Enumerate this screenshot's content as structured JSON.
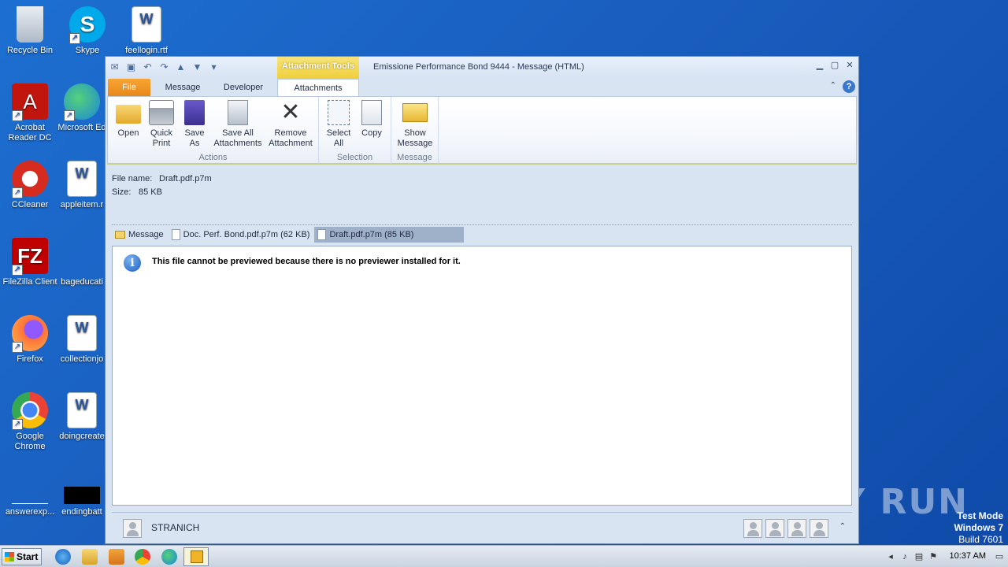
{
  "desktop": {
    "icons": [
      {
        "label": "Recycle Bin"
      },
      {
        "label": "Skype"
      },
      {
        "label": "feellogin.rtf"
      },
      {
        "label": "Acrobat Reader DC"
      },
      {
        "label": "Microsoft Ed"
      },
      {
        "label": "CCleaner"
      },
      {
        "label": "appleitem.r"
      },
      {
        "label": "FileZilla Client"
      },
      {
        "label": "bageducati"
      },
      {
        "label": "Firefox"
      },
      {
        "label": "collectionjo"
      },
      {
        "label": "Google Chrome"
      },
      {
        "label": "doingcreate"
      },
      {
        "label": "answerexp..."
      },
      {
        "label": "endingbatt"
      }
    ],
    "watermark": "ANY RUN",
    "test_mode": {
      "line1": "Test Mode",
      "line2": "Windows 7",
      "line3": "Build 7601"
    }
  },
  "window": {
    "contextual_tab_group": "Attachment Tools",
    "title": "Emissione Performance Bond 9444 -  Message (HTML)",
    "tabs": [
      {
        "label": "File"
      },
      {
        "label": "Message"
      },
      {
        "label": "Developer"
      },
      {
        "label": "Attachments"
      }
    ],
    "help_label": "?",
    "ribbon": {
      "groups": [
        {
          "label": "Actions",
          "buttons": [
            {
              "line1": "Open",
              "line2": "",
              "icon": "folder-open-icon"
            },
            {
              "line1": "Quick",
              "line2": "Print",
              "icon": "printer-icon"
            },
            {
              "line1": "Save",
              "line2": "As",
              "icon": "save-as-icon"
            },
            {
              "line1": "Save All",
              "line2": "Attachments",
              "icon": "save-all-icon"
            },
            {
              "line1": "Remove",
              "line2": "Attachment",
              "icon": "remove-x-icon"
            }
          ]
        },
        {
          "label": "Selection",
          "buttons": [
            {
              "line1": "Select",
              "line2": "All",
              "icon": "select-all-icon"
            },
            {
              "line1": "Copy",
              "line2": "",
              "icon": "copy-icon"
            }
          ]
        },
        {
          "label": "Message",
          "buttons": [
            {
              "line1": "Show",
              "line2": "Message",
              "icon": "envelope-icon"
            }
          ]
        }
      ]
    },
    "attachment_info": {
      "file_name_label": "File name:",
      "file_name": "Draft.pdf.p7m",
      "size_label": "Size:",
      "size": "85 KB"
    },
    "attachment_tabs": [
      {
        "label": "Message"
      },
      {
        "label": "Doc. Perf. Bond.pdf.p7m (62 KB)"
      },
      {
        "label": "Draft.pdf.p7m (85 KB)"
      }
    ],
    "preview_message": "This file cannot be previewed because there is no previewer installed for it.",
    "people_pane": {
      "name": "STRANICH"
    }
  },
  "taskbar": {
    "start_label": "Start",
    "clock": "10:37 AM"
  }
}
